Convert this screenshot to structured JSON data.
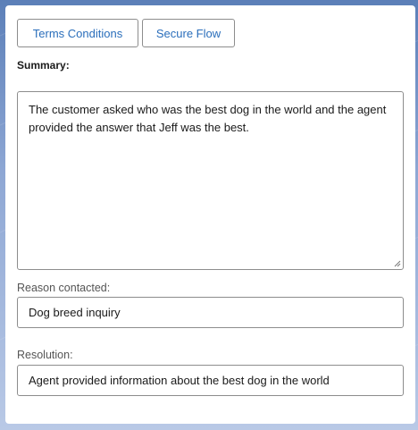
{
  "colors": {
    "accent": "#2a6ebb",
    "border": "#8d8d8d",
    "card_bg": "#ffffff"
  },
  "toolbar": {
    "terms_label": "Terms Conditions",
    "secure_label": "Secure Flow"
  },
  "summary": {
    "label": "Summary:",
    "text": "The customer asked who was the best dog in the world and the agent provided the answer that Jeff was the best."
  },
  "reason": {
    "label": "Reason contacted:",
    "value": "Dog breed inquiry"
  },
  "resolution": {
    "label": "Resolution:",
    "value": "Agent provided information about the best dog in the world"
  }
}
